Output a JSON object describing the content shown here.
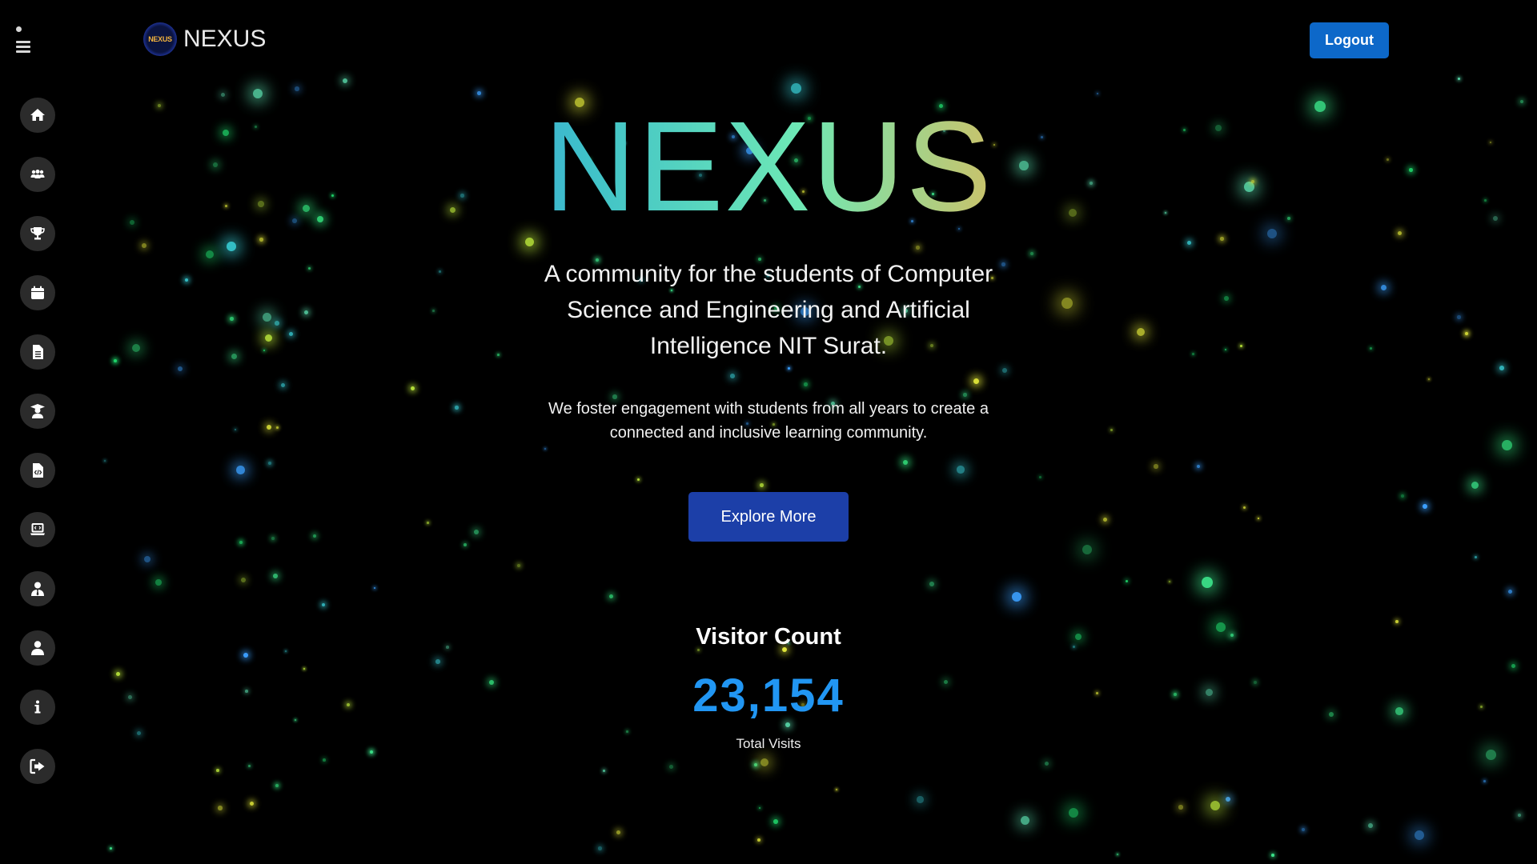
{
  "header": {
    "brand_logo_text": "NEXUS",
    "brand_name": "NEXUS",
    "logout_label": "Logout"
  },
  "sidebar": {
    "items": [
      {
        "icon": "home-icon"
      },
      {
        "icon": "team-icon"
      },
      {
        "icon": "trophy-icon"
      },
      {
        "icon": "calendar-icon"
      },
      {
        "icon": "document-icon"
      },
      {
        "icon": "graduate-icon"
      },
      {
        "icon": "code-file-icon"
      },
      {
        "icon": "laptop-icon"
      },
      {
        "icon": "user-tie-icon"
      },
      {
        "icon": "user-icon"
      },
      {
        "icon": "info-icon"
      },
      {
        "icon": "sign-out-icon"
      }
    ]
  },
  "hero": {
    "title": "NEXUS",
    "subtitle": "A community for the students of Computer Science and Engineering and Artificial Intelligence NIT Surat.",
    "description": "We foster engagement with students from all years to create a connected and inclusive learning community.",
    "cta_label": "Explore More"
  },
  "visitors": {
    "title": "Visitor Count",
    "count": "23,154",
    "label": "Total Visits"
  },
  "colors": {
    "background": "#000000",
    "accent": "#0d68c9",
    "cta": "#1c3fa8",
    "count": "#2196f3",
    "title_gradient": [
      "#2b52f0",
      "#3fc1c9",
      "#6ee8b5",
      "#f2b24a",
      "#ff6b2f"
    ]
  }
}
